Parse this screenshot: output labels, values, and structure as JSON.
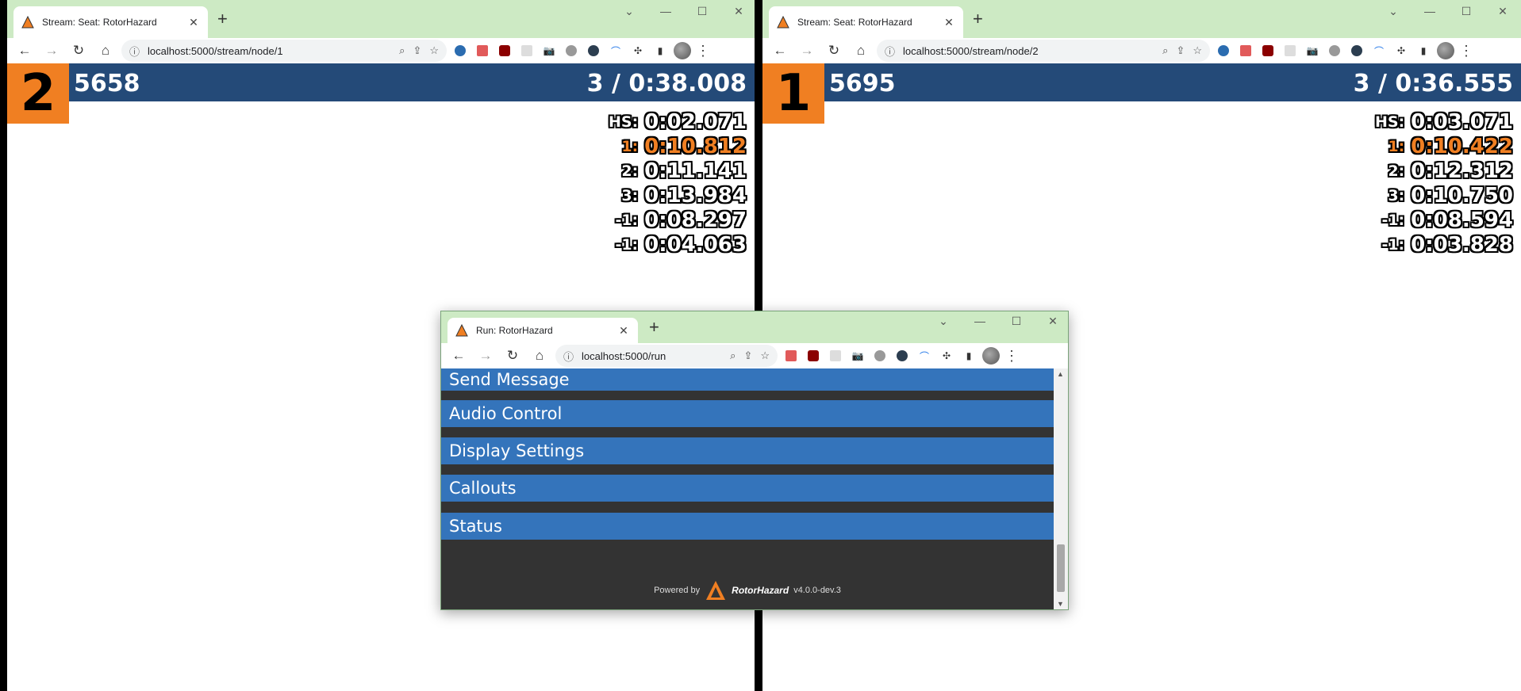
{
  "left_window": {
    "tab_title": "Stream: Seat: RotorHazard",
    "url": "localhost:5000/stream/node/1",
    "seat_number": "2",
    "callsign": "5658",
    "lap_total": "3 / 0:38.008",
    "laps": [
      {
        "label": "HS:",
        "time": "0:02.071",
        "best": false
      },
      {
        "label": "1:",
        "time": "0:10.812",
        "best": true
      },
      {
        "label": "2:",
        "time": "0:11.141",
        "best": false
      },
      {
        "label": "3:",
        "time": "0:13.984",
        "best": false
      },
      {
        "label": "-1:",
        "time": "0:08.297",
        "best": false
      },
      {
        "label": "-1:",
        "time": "0:04.063",
        "best": false
      }
    ]
  },
  "right_window": {
    "tab_title": "Stream: Seat: RotorHazard",
    "url": "localhost:5000/stream/node/2",
    "seat_number": "1",
    "callsign": "5695",
    "lap_total": "3 / 0:36.555",
    "laps": [
      {
        "label": "HS:",
        "time": "0:03.071",
        "best": false
      },
      {
        "label": "1:",
        "time": "0:10.422",
        "best": true
      },
      {
        "label": "2:",
        "time": "0:12.312",
        "best": false
      },
      {
        "label": "3:",
        "time": "0:10.750",
        "best": false
      },
      {
        "label": "-1:",
        "time": "0:08.594",
        "best": false
      },
      {
        "label": "-1:",
        "time": "0:03.828",
        "best": false
      }
    ]
  },
  "popup_window": {
    "tab_title": "Run: RotorHazard",
    "url": "localhost:5000/run",
    "panels": [
      "Send Message",
      "Audio Control",
      "Display Settings",
      "Callouts",
      "Status"
    ],
    "footer": {
      "powered_by": "Powered by",
      "brand": "RotorHazard",
      "version": "v4.0.0-dev.3"
    }
  },
  "colors": {
    "header_blue": "#244a78",
    "seat_orange": "#f07f22",
    "panel_blue": "#3474bb",
    "panel_bg": "#333333",
    "chrome_green": "#cdeac4"
  },
  "icons": {
    "back": "arrow-left-icon",
    "forward": "arrow-right-icon",
    "reload": "reload-icon",
    "home": "home-icon",
    "info": "info-icon",
    "zoom": "zoom-icon",
    "share": "share-icon",
    "star": "star-icon"
  }
}
